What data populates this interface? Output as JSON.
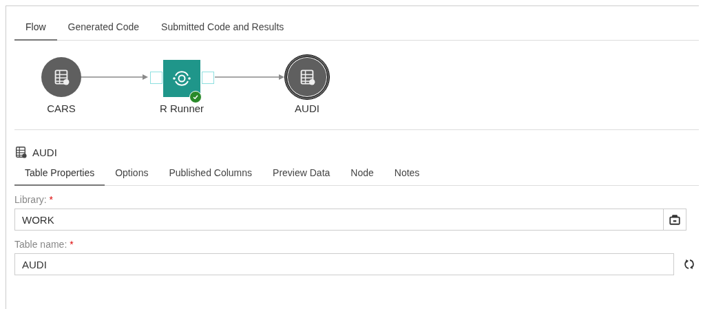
{
  "top_tabs": [
    {
      "label": "Flow",
      "selected": true
    },
    {
      "label": "Generated Code",
      "selected": false
    },
    {
      "label": "Submitted Code and Results",
      "selected": false
    }
  ],
  "flow": {
    "nodes": [
      {
        "label": "CARS",
        "kind": "table",
        "selected": false
      },
      {
        "label": "R Runner",
        "kind": "step",
        "completed": true,
        "selected": false
      },
      {
        "label": "AUDI",
        "kind": "table",
        "selected": true
      }
    ]
  },
  "details": {
    "title": "AUDI",
    "tabs": [
      {
        "label": "Table Properties",
        "selected": true
      },
      {
        "label": "Options",
        "selected": false
      },
      {
        "label": "Published Columns",
        "selected": false
      },
      {
        "label": "Preview Data",
        "selected": false
      },
      {
        "label": "Node",
        "selected": false
      },
      {
        "label": "Notes",
        "selected": false
      }
    ],
    "fields": [
      {
        "label": "Library:",
        "required_mark": "*",
        "value": "WORK",
        "kind": "browse"
      },
      {
        "label": "Table name:",
        "required_mark": "*",
        "value": "AUDI",
        "kind": "refresh"
      }
    ]
  }
}
